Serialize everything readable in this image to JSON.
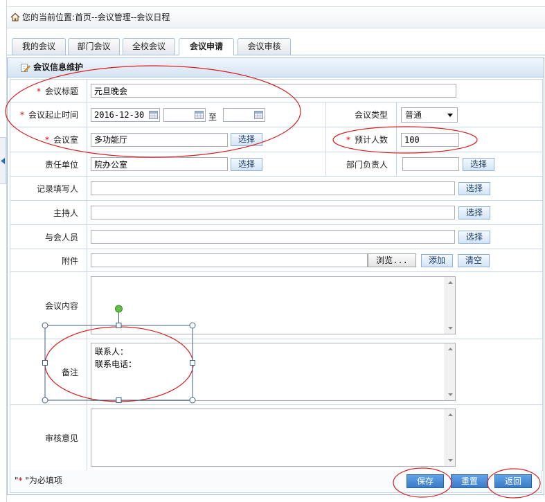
{
  "breadcrumb": {
    "text": "您的当前位置:首页--会议管理--会议日程"
  },
  "tabs": [
    {
      "label": "我的会议",
      "active": false
    },
    {
      "label": "部门会议",
      "active": false
    },
    {
      "label": "全校会议",
      "active": false
    },
    {
      "label": "会议申请",
      "active": true
    },
    {
      "label": "会议审核",
      "active": false
    }
  ],
  "panel": {
    "title": "会议信息维护"
  },
  "form": {
    "required_mark": "*",
    "title": {
      "label": "会议标题",
      "value": "元旦晚会"
    },
    "time": {
      "label": "会议起止时间",
      "start": "2016-12-30",
      "middle": "",
      "end": "",
      "separator": "至"
    },
    "type": {
      "label": "会议类型",
      "value": "普通"
    },
    "room": {
      "label": "会议室",
      "value": "多功能厅",
      "button": "选择"
    },
    "attendance": {
      "label": "预计人数",
      "value": "100"
    },
    "department": {
      "label": "责任单位",
      "value": "院办公室",
      "button": "选择"
    },
    "department_head": {
      "label": "部门负责人",
      "value": "",
      "button": "选择"
    },
    "recorder": {
      "label": "记录填写人",
      "value": "",
      "button": "选择"
    },
    "host": {
      "label": "主持人",
      "value": "",
      "button": "选择"
    },
    "participants": {
      "label": "与会人员",
      "value": "",
      "button": "选择"
    },
    "attachment": {
      "label": "附件",
      "value": "",
      "browse": "浏览...",
      "add": "添加",
      "clear": "清空"
    },
    "content": {
      "label": "会议内容",
      "value": ""
    },
    "remarks": {
      "label": "备注",
      "value": "联系人：\n联系电话："
    },
    "review": {
      "label": "审核意见",
      "value": ""
    }
  },
  "footer": {
    "note_open": "\"",
    "note_mark": "*",
    "note_close": " \"为必填项",
    "save": "保存",
    "reset": "重置",
    "back": "返回"
  },
  "icons": {
    "home": "home-icon",
    "panel": "edit-icon",
    "calendar": "calendar-icon",
    "dropdown": "chevron-down-icon",
    "collapse": "collapse-left-icon",
    "scroll_up": "scroll-up-icon",
    "scroll_down": "scroll-down-icon"
  },
  "colors": {
    "required": "#e00000",
    "annotation": "#d81e1e",
    "primary_button": "#3a7bc8",
    "panel_border": "#a3bfdc",
    "selection": "#3e5f8a",
    "rotate_handle": "#66bb44"
  }
}
